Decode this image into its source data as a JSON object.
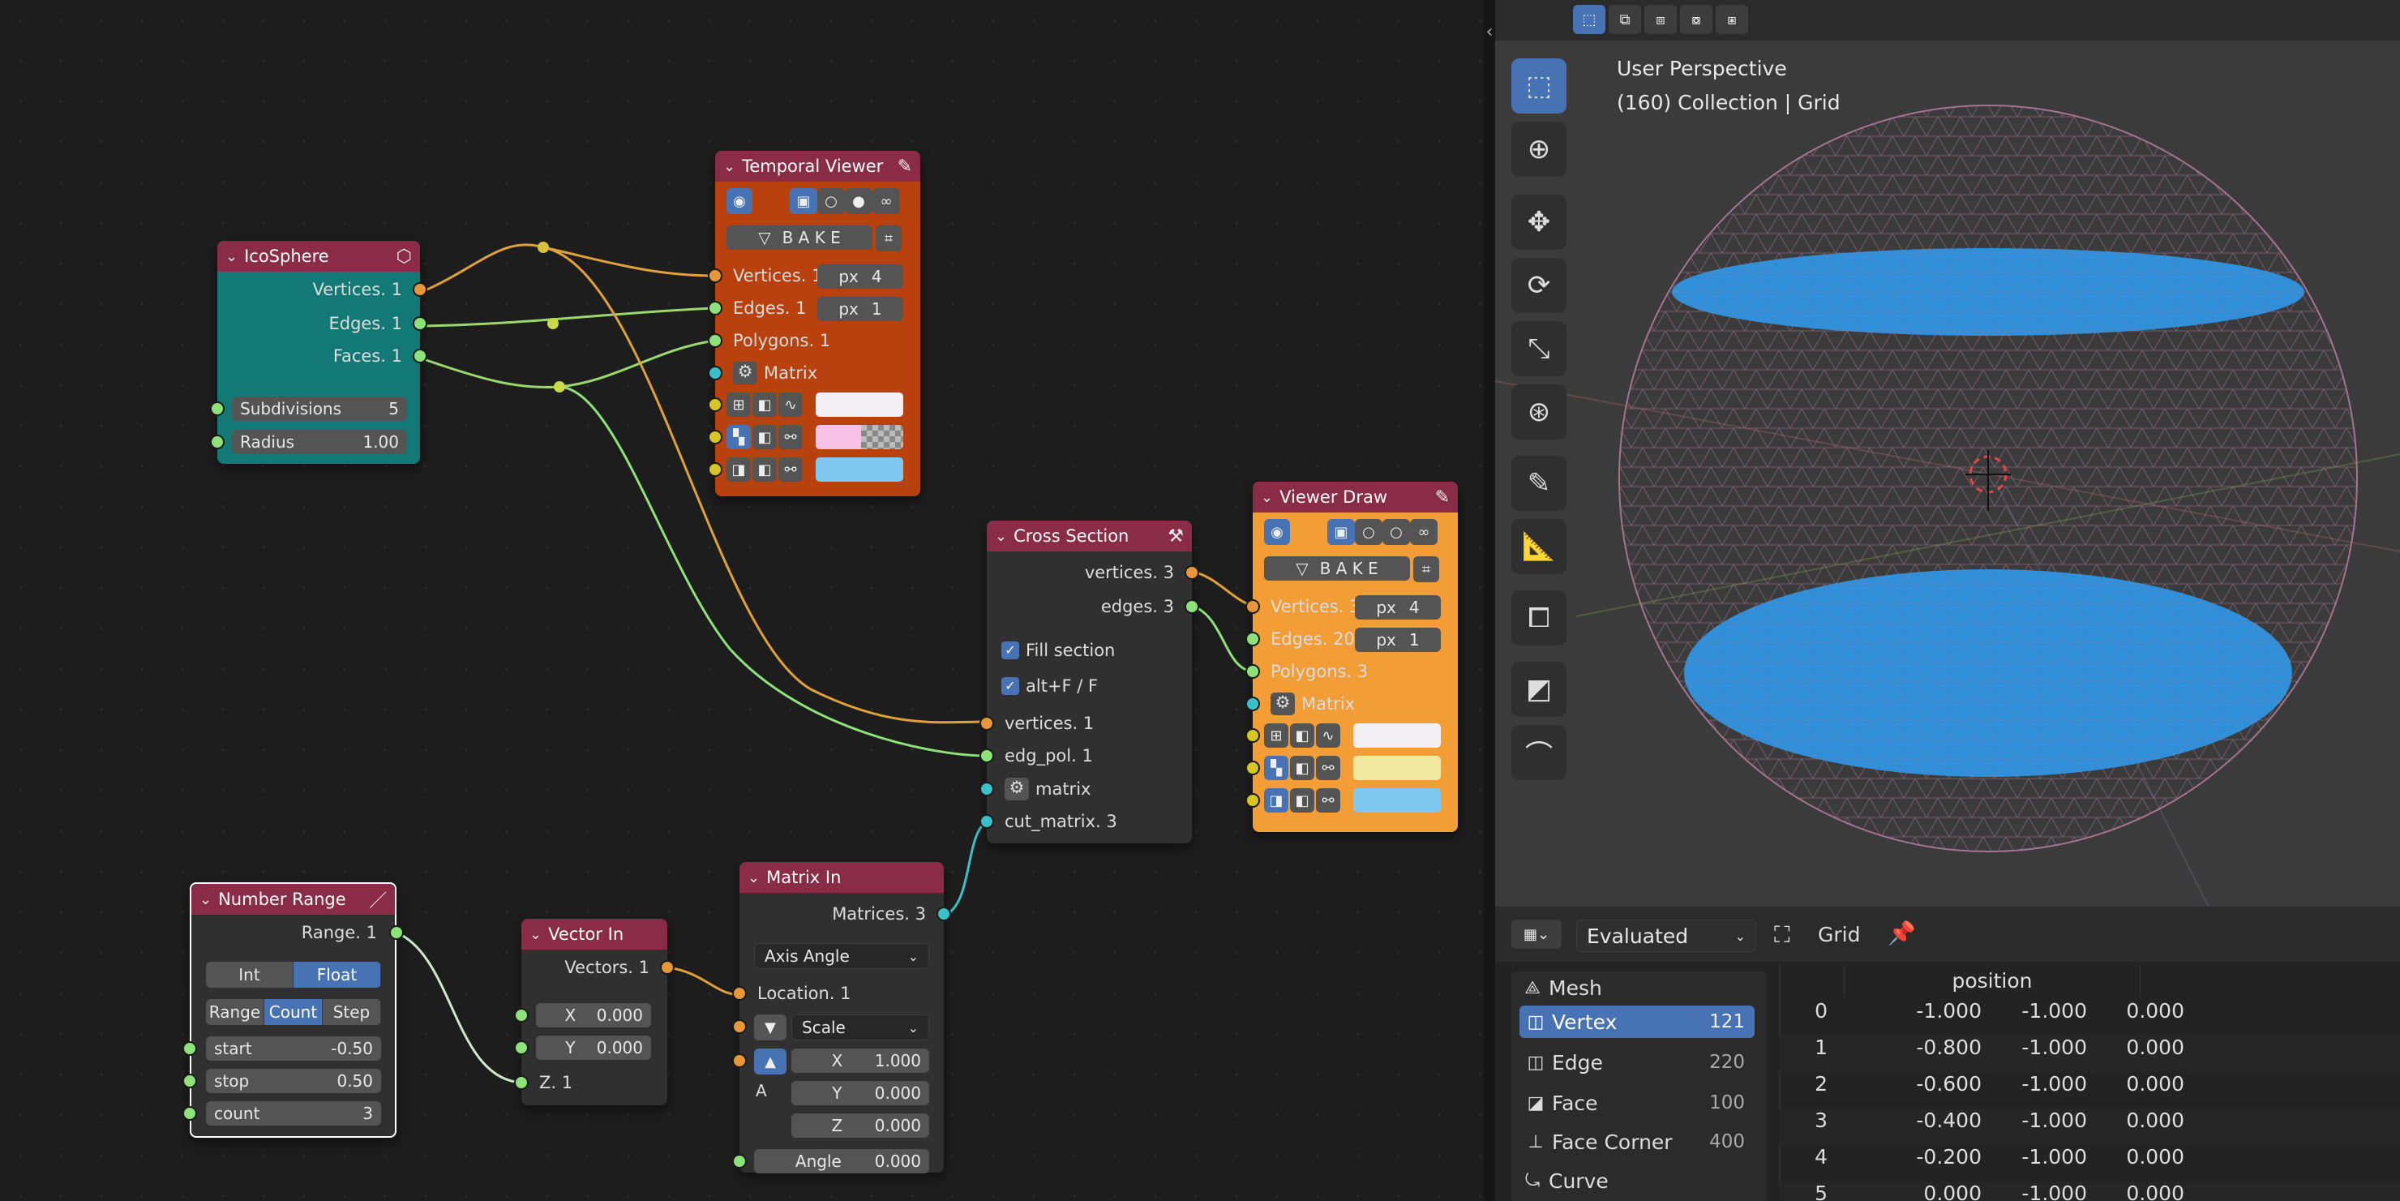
{
  "nodes": {
    "icosphere": {
      "title": "IcoSphere",
      "outputs": [
        "Vertices. 1",
        "Edges. 1",
        "Faces. 1"
      ],
      "subdivisions_label": "Subdivisions",
      "subdivisions_value": "5",
      "radius_label": "Radius",
      "radius_value": "1.00"
    },
    "temporal_viewer": {
      "title": "Temporal Viewer",
      "bake": "B A K E",
      "inputs": [
        "Vertices. 1",
        "Edges. 1",
        "Polygons. 1",
        "Matrix"
      ],
      "vert_px_unit": "px",
      "vert_px_value": "4",
      "edge_px_unit": "px",
      "edge_px_value": "1",
      "colors": [
        "#f2f0f4",
        "#f7c2e6",
        "#7fc8ef"
      ]
    },
    "cross_section": {
      "title": "Cross Section",
      "outputs": [
        "vertices. 3",
        "edges. 3"
      ],
      "fill_section": "Fill section",
      "alt_f": "alt+F / F",
      "inputs": [
        "vertices. 1",
        "edg_pol. 1",
        "matrix",
        "cut_matrix. 3"
      ]
    },
    "viewer_draw": {
      "title": "Viewer Draw",
      "bake": "B A K E",
      "inputs": [
        "Vertices. 3",
        "Edges. 20",
        "Polygons. 3",
        "Matrix"
      ],
      "vert_px_unit": "px",
      "vert_px_value": "4",
      "edge_px_unit": "px",
      "edge_px_value": "1",
      "colors": [
        "#f2f0f4",
        "#f2e9a0",
        "#7fc8ef"
      ]
    },
    "number_range": {
      "title": "Number Range",
      "output": "Range. 1",
      "mode": [
        "Int",
        "Float"
      ],
      "sub": [
        "Range",
        "Count",
        "Step"
      ],
      "start_label": "start",
      "start_value": "-0.50",
      "stop_label": "stop",
      "stop_value": "0.50",
      "count_label": "count",
      "count_value": "3"
    },
    "vector_in": {
      "title": "Vector In",
      "output": "Vectors. 1",
      "x_label": "X",
      "x_value": "0.000",
      "y_label": "Y",
      "y_value": "0.000",
      "z_input": "Z. 1"
    },
    "matrix_in": {
      "title": "Matrix In",
      "output": "Matrices. 3",
      "mode": "Axis Angle",
      "location": "Location. 1",
      "scale": "Scale",
      "x_label": "X",
      "x_value": "1.000",
      "y_label": "Y",
      "y_value": "0.000",
      "z_label": "Z",
      "z_value": "0.000",
      "a_label": "A",
      "angle_label": "Angle",
      "angle_value": "0.000"
    }
  },
  "viewport": {
    "line1": "User Perspective",
    "line2": "(160) Collection | Grid"
  },
  "spreadsheet": {
    "evaluated": "Evaluated",
    "object": "Grid",
    "column": "position",
    "domains": [
      {
        "label": "Mesh",
        "count": ""
      },
      {
        "label": "Vertex",
        "count": "121"
      },
      {
        "label": "Edge",
        "count": "220"
      },
      {
        "label": "Face",
        "count": "100"
      },
      {
        "label": "Face Corner",
        "count": "400"
      },
      {
        "label": "Curve",
        "count": ""
      }
    ],
    "rows": [
      [
        "0",
        "-1.000",
        "-1.000",
        "0.000"
      ],
      [
        "1",
        "-0.800",
        "-1.000",
        "0.000"
      ],
      [
        "2",
        "-0.600",
        "-1.000",
        "0.000"
      ],
      [
        "3",
        "-0.400",
        "-1.000",
        "0.000"
      ],
      [
        "4",
        "-0.200",
        "-1.000",
        "0.000"
      ],
      [
        "5",
        "0.000",
        "-1.000",
        "0.000"
      ]
    ]
  },
  "colors": {
    "accent": "#4772b3",
    "node_header": "#8a2b47",
    "icosphere": "#137977",
    "temporal": "#b8410d",
    "viewer_draw": "#f39d36",
    "mesh_fill": "#2f8fd8"
  }
}
